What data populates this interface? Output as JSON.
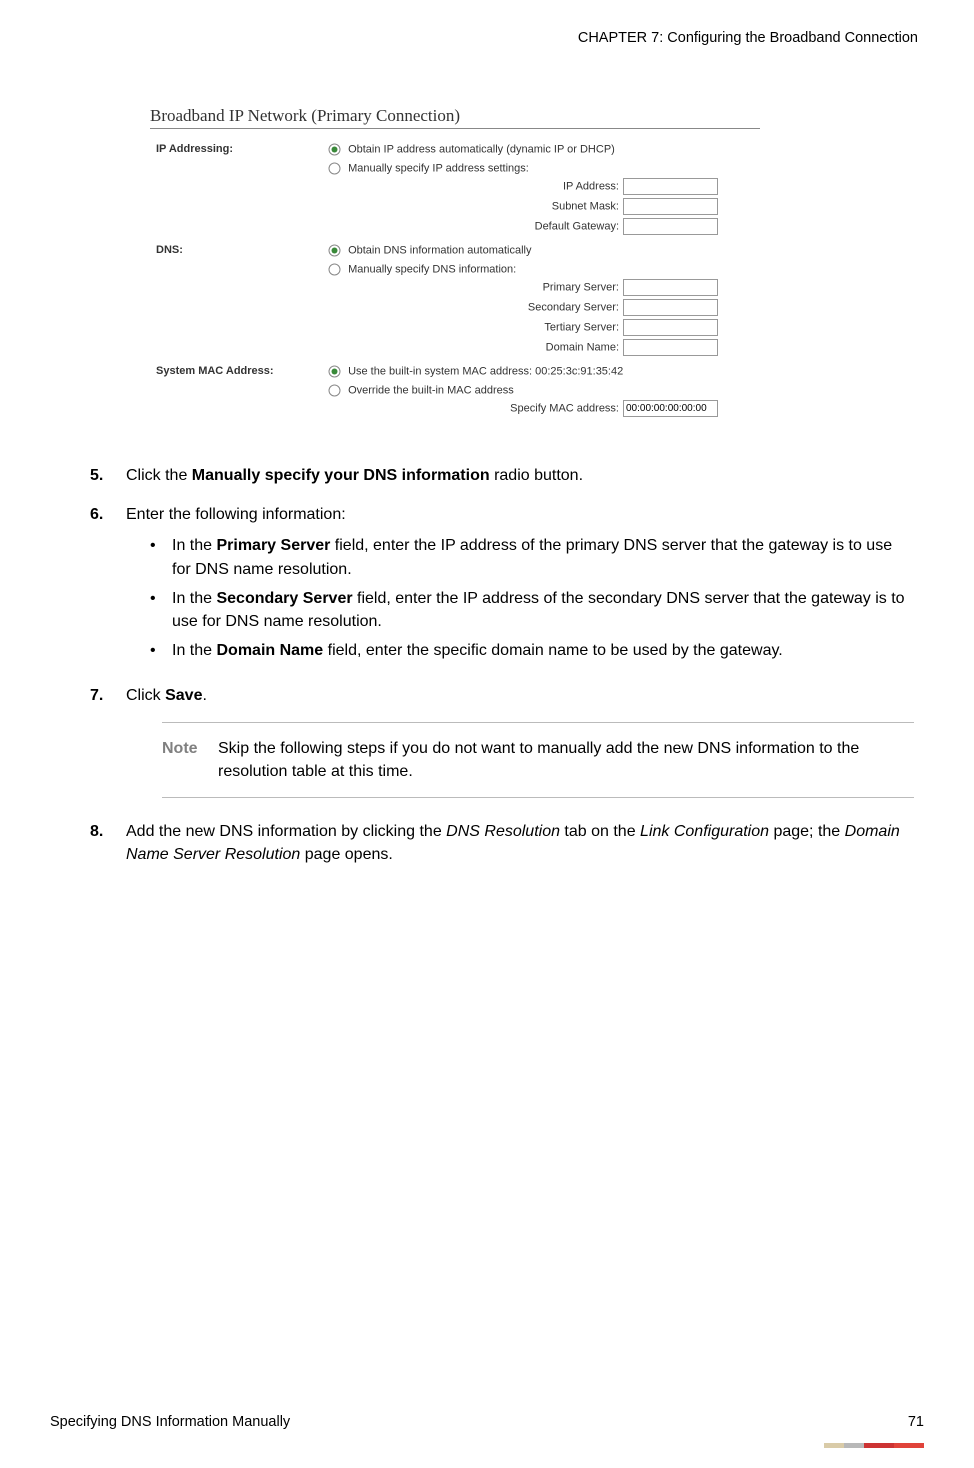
{
  "header": {
    "chapter": "CHAPTER 7: Configuring the Broadband Connection"
  },
  "footer": {
    "section": "Specifying DNS Information Manually",
    "page": "71"
  },
  "screenshot": {
    "title": "Broadband IP Network (Primary Connection)",
    "ip_addressing": {
      "label": "IP Addressing:",
      "opt_auto": "Obtain IP address automatically (dynamic IP or DHCP)",
      "opt_manual": "Manually specify IP address settings:",
      "ip_address": "IP Address:",
      "subnet_mask": "Subnet Mask:",
      "default_gateway": "Default Gateway:"
    },
    "dns": {
      "label": "DNS:",
      "opt_auto": "Obtain DNS information automatically",
      "opt_manual": "Manually specify DNS information:",
      "primary": "Primary Server:",
      "secondary": "Secondary Server:",
      "tertiary": "Tertiary Server:",
      "domain": "Domain Name:"
    },
    "mac": {
      "label": "System MAC Address:",
      "opt_builtin_pre": "Use the built-in system MAC address: ",
      "builtin_value": "00:25:3c:91:35:42",
      "opt_override": "Override the built-in MAC address",
      "specify": "Specify MAC address:",
      "specify_value": "00:00:00:00:00:00"
    }
  },
  "steps": {
    "s5": {
      "num": "5.",
      "pre": "Click the ",
      "bold": "Manually specify your DNS information",
      "post": " radio button."
    },
    "s6": {
      "num": "6.",
      "intro": "Enter the following information:",
      "b1_pre": "In the ",
      "b1_bold": "Primary Server",
      "b1_post": " field, enter the IP address of the primary DNS server that the gateway is to use for DNS name resolution.",
      "b2_pre": "In the ",
      "b2_bold": "Secondary Server",
      "b2_post": " field, enter the IP address of the secondary DNS server that the gateway is to use for DNS name resolution.",
      "b3_pre": "In the ",
      "b3_bold": "Domain Name",
      "b3_post": " field, enter the specific domain name to be used by the gateway."
    },
    "s7": {
      "num": "7.",
      "pre": "Click ",
      "bold": "Save",
      "post": "."
    },
    "note": {
      "label": "Note",
      "text": "Skip the following steps if you do not want to manually add the new DNS information to the resolution table at this time."
    },
    "s8": {
      "num": "8.",
      "t1": "Add the new DNS information by clicking the ",
      "i1": "DNS Resolution",
      "t2": " tab on the ",
      "i2": "Link Configuration",
      "t3": " page; the ",
      "i3": "Domain Name Server Resolution",
      "t4": " page opens."
    }
  }
}
